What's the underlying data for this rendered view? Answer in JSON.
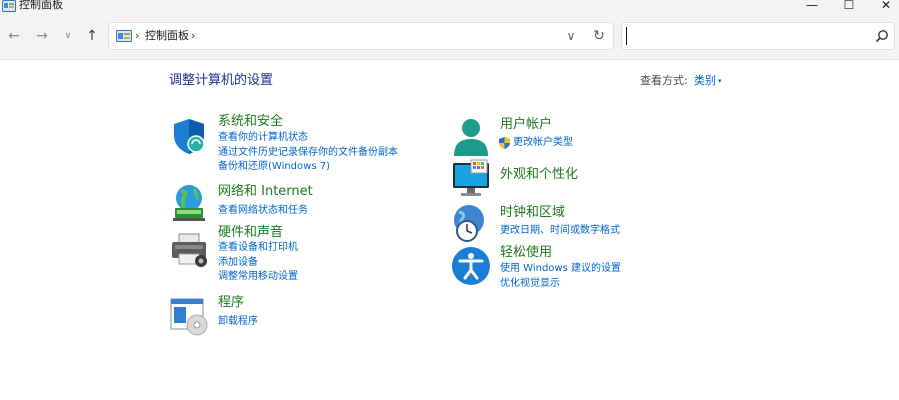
{
  "window": {
    "title": "控制面板",
    "minimize_glyph": "—",
    "maximize_glyph": "☐",
    "close_glyph": "✕"
  },
  "nav": {
    "back_glyph": "←",
    "forward_glyph": "→",
    "recent_glyph": "∨",
    "up_glyph": "↑"
  },
  "address": {
    "separator": "›",
    "crumb": "控制面板",
    "trailing_separator": "›",
    "dropdown_glyph": "∨",
    "refresh_glyph": "↻"
  },
  "search": {
    "value": "",
    "placeholder": ""
  },
  "main": {
    "title": "调整计算机的设置",
    "view_by_label": "查看方式:",
    "view_by_value": "类别",
    "view_by_caret": "▾"
  },
  "categories": {
    "system": {
      "title": "系统和安全",
      "links": [
        "查看你的计算机状态",
        "通过文件历史记录保存你的文件备份副本",
        "备份和还原(Windows 7)"
      ]
    },
    "network": {
      "title": "网络和 Internet",
      "links": [
        "查看网络状态和任务"
      ]
    },
    "hardware": {
      "title": "硬件和声音",
      "links": [
        "查看设备和打印机",
        "添加设备",
        "调整常用移动设置"
      ]
    },
    "programs": {
      "title": "程序",
      "links": [
        "卸载程序"
      ]
    },
    "user": {
      "title": "用户帐户",
      "links": [
        "更改帐户类型"
      ]
    },
    "appearance": {
      "title": "外观和个性化",
      "links": []
    },
    "clock": {
      "title": "时钟和区域",
      "links": [
        "更改日期、时间或数字格式"
      ]
    },
    "ease": {
      "title": "轻松使用",
      "links": [
        "使用 Windows 建议的设置",
        "优化视觉显示"
      ]
    }
  },
  "icons": {
    "app": "control-panel-icon",
    "search": "search-icon",
    "system": "shield-icon",
    "network": "network-globe-icon",
    "hardware": "printer-icon",
    "programs": "programs-disc-icon",
    "user": "user-icon",
    "appearance": "monitor-color-icon",
    "clock": "clock-globe-icon",
    "ease": "accessibility-icon"
  },
  "colors": {
    "category_title": "#1e7a1e",
    "link": "#0066cc",
    "page_title": "#1e3287",
    "chrome": "#f3f3f3"
  }
}
